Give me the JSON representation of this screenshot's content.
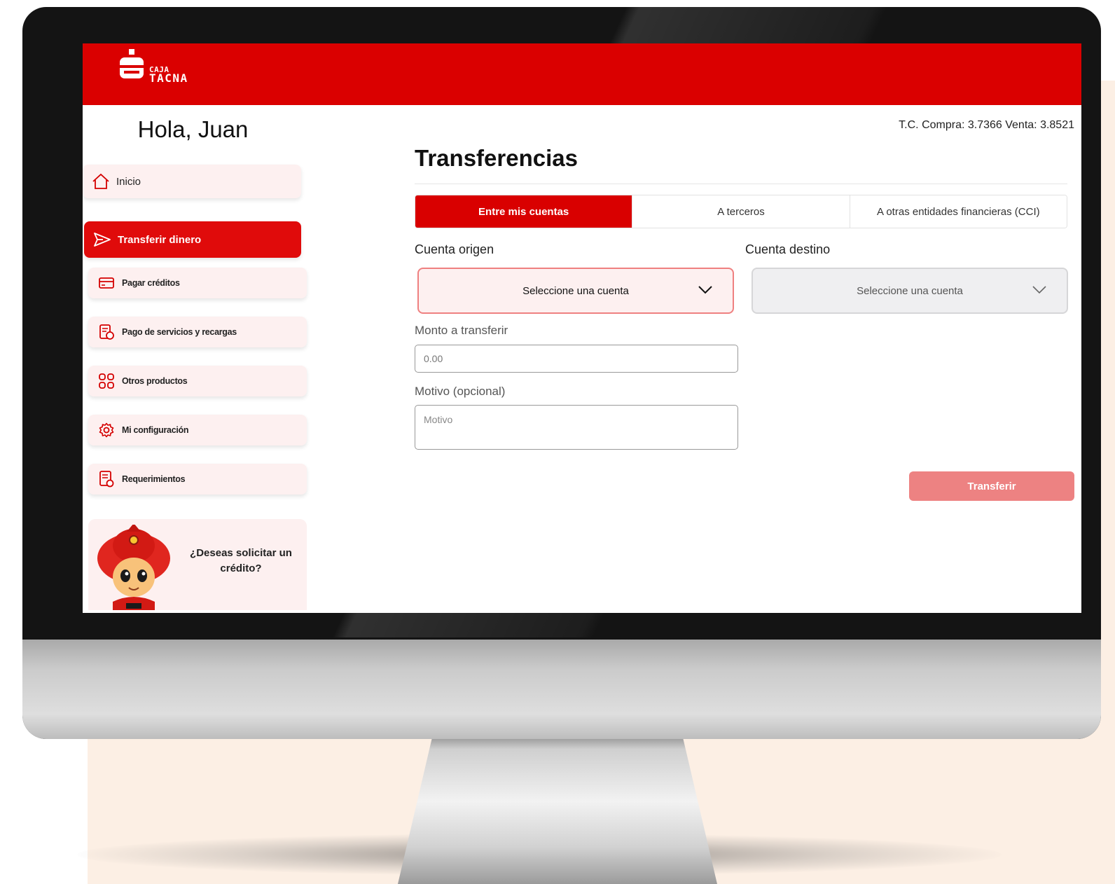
{
  "brand": {
    "line1": "CAJA",
    "line2": "TACNA",
    "primary_color": "#da0000",
    "accent_light": "#fdf0f0"
  },
  "sidebar": {
    "greeting": "Hola, Juan",
    "items": [
      {
        "label": "Inicio",
        "icon": "home-icon"
      },
      {
        "label": "Transferir dinero",
        "icon": "send-icon",
        "active": true
      },
      {
        "label": "Pagar créditos",
        "icon": "credit-card-icon"
      },
      {
        "label": "Pago de servicios y recargas",
        "icon": "bill-payment-icon"
      },
      {
        "label": "Otros productos",
        "icon": "grid-icon"
      },
      {
        "label": "Mi configuración",
        "icon": "gear-icon"
      },
      {
        "label": "Requerimientos",
        "icon": "document-icon"
      }
    ],
    "promo": {
      "text": "¿Deseas solicitar un crédito?"
    }
  },
  "main": {
    "exchange_rate": "T.C. Compra: 3.7366 Venta: 3.8521",
    "title": "Transferencias",
    "tabs": [
      {
        "label": "Entre mis cuentas",
        "active": true
      },
      {
        "label": "A terceros"
      },
      {
        "label": "A otras entidades financieras (CCI)"
      }
    ],
    "origin": {
      "label": "Cuenta origen",
      "value": "Seleccione una cuenta"
    },
    "destination": {
      "label": "Cuenta destino",
      "value": "Seleccione una cuenta"
    },
    "amount": {
      "label": "Monto a transferir",
      "placeholder": "0.00"
    },
    "reason": {
      "label": "Motivo (opcional)",
      "placeholder": "Motivo"
    },
    "submit_label": "Transferir"
  }
}
